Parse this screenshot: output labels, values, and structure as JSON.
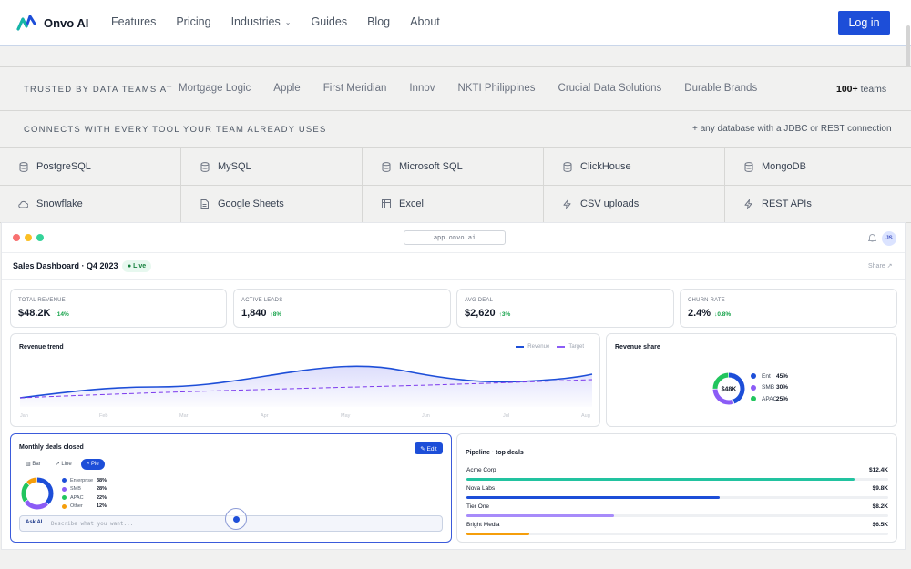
{
  "nav": {
    "brand": "Onvo AI",
    "links": [
      "Features",
      "Pricing",
      "Industries",
      "Guides",
      "Blog",
      "About"
    ],
    "login_label": "Log in"
  },
  "trusted": {
    "label": "TRUSTED BY DATA TEAMS AT",
    "brands": [
      "Mortgage Logic",
      "Apple",
      "First Meridian",
      "Innov",
      "NKTI Philippines",
      "Crucial Data Solutions",
      "Durable Brands"
    ],
    "count_bold": "100+",
    "count_rest": " teams"
  },
  "connects": {
    "label": "CONNECTS WITH EVERY TOOL YOUR TEAM ALREADY USES",
    "note": "+ any database with a JDBC or REST connection"
  },
  "tools": [
    {
      "name": "PostgreSQL",
      "icon": "database-icon"
    },
    {
      "name": "MySQL",
      "icon": "database-icon"
    },
    {
      "name": "Microsoft SQL",
      "icon": "database-icon"
    },
    {
      "name": "ClickHouse",
      "icon": "database-icon"
    },
    {
      "name": "MongoDB",
      "icon": "database-icon"
    },
    {
      "name": "Snowflake",
      "icon": "cloud-icon"
    },
    {
      "name": "Google Sheets",
      "icon": "sheet-icon"
    },
    {
      "name": "Excel",
      "icon": "table-icon"
    },
    {
      "name": "CSV uploads",
      "icon": "bolt-icon"
    },
    {
      "name": "REST APIs",
      "icon": "bolt-icon"
    }
  ],
  "app": {
    "url": "app.onvo.ai",
    "avatar": "JS",
    "title": "Sales Dashboard · Q4 2023",
    "live": "● Live",
    "share": "Share ↗",
    "kpis": [
      {
        "label": "TOTAL REVENUE",
        "value": "$48.2K",
        "delta": "↑14%",
        "direction": "up"
      },
      {
        "label": "ACTIVE LEADS",
        "value": "1,840",
        "delta": "↑8%",
        "direction": "up"
      },
      {
        "label": "AVG DEAL",
        "value": "$2,620",
        "delta": "↑3%",
        "direction": "up"
      },
      {
        "label": "CHURN RATE",
        "value": "2.4%",
        "delta": "↓0.8%",
        "direction": "down"
      }
    ],
    "revenue_trend": {
      "title": "Revenue trend",
      "legend": [
        "Revenue",
        "Target"
      ],
      "months": [
        "Jan",
        "Feb",
        "Mar",
        "Apr",
        "May",
        "Jun",
        "Jul",
        "Aug"
      ]
    },
    "revenue_share": {
      "title": "Revenue share",
      "center": "$48K",
      "slices": [
        {
          "name": "Ent",
          "pct": "45%",
          "value": 45,
          "color": "#1d4ed8"
        },
        {
          "name": "SMB",
          "pct": "30%",
          "value": 30,
          "color": "#8b5cf6"
        },
        {
          "name": "APAC",
          "pct": "25%",
          "value": 25,
          "color": "#22c55e"
        }
      ]
    },
    "monthly_deals": {
      "title": "Monthly deals closed",
      "edit_label": "✎ Edit",
      "tabs": [
        {
          "label": "▥ Bar",
          "active": false
        },
        {
          "label": "↗ Line",
          "active": false
        },
        {
          "label": "◔ Pie",
          "active": true
        }
      ],
      "slices": [
        {
          "name": "Enterprise",
          "pct": "38%",
          "value": 38,
          "color": "#1d4ed8"
        },
        {
          "name": "SMB",
          "pct": "28%",
          "value": 28,
          "color": "#8b5cf6"
        },
        {
          "name": "APAC",
          "pct": "22%",
          "value": 22,
          "color": "#22c55e"
        },
        {
          "name": "Other",
          "pct": "12%",
          "value": 12,
          "color": "#f59e0b"
        }
      ],
      "ask_label": "Ask AI",
      "ask_placeholder": "Describe what you want..."
    },
    "pipeline": {
      "title": "Pipeline · top deals",
      "deals": [
        {
          "name": "Acme Corp",
          "value": "$12.4K",
          "fill": 0.92,
          "color": "#22c3a0"
        },
        {
          "name": "Nova Labs",
          "value": "$9.8K",
          "fill": 0.6,
          "color": "#1d4ed8"
        },
        {
          "name": "Tier One",
          "value": "$8.2K",
          "fill": 0.35,
          "color": "#a78bfa"
        },
        {
          "name": "Bright Media",
          "value": "$6.5K",
          "fill": 0.15,
          "color": "#f59e0b"
        }
      ]
    }
  }
}
